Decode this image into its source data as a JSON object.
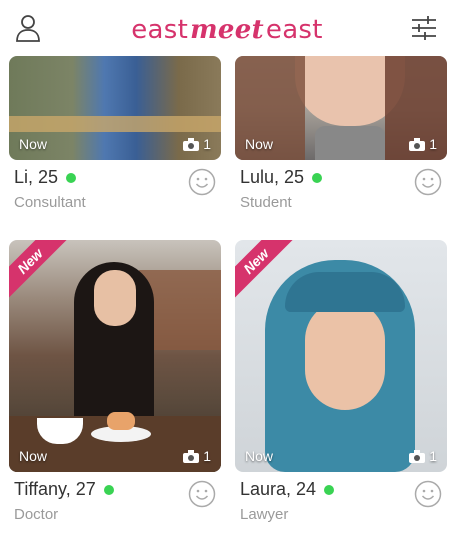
{
  "header": {
    "logo_part1": "east",
    "logo_part2": "meet",
    "logo_part3": "east",
    "brand_color": "#d6336c"
  },
  "cards": [
    {
      "name": "Li, 25",
      "job": "Consultant",
      "status": "Now",
      "photo_count": "1",
      "new_badge": ""
    },
    {
      "name": "Lulu, 25",
      "job": "Student",
      "status": "Now",
      "photo_count": "1",
      "new_badge": ""
    },
    {
      "name": "Tiffany, 27",
      "job": "Doctor",
      "status": "Now",
      "photo_count": "1",
      "new_badge": "New"
    },
    {
      "name": "Laura, 24",
      "job": "Lawyer",
      "status": "Now",
      "photo_count": "1",
      "new_badge": "New"
    }
  ],
  "colors": {
    "online": "#39d353",
    "accent": "#d6336c"
  }
}
